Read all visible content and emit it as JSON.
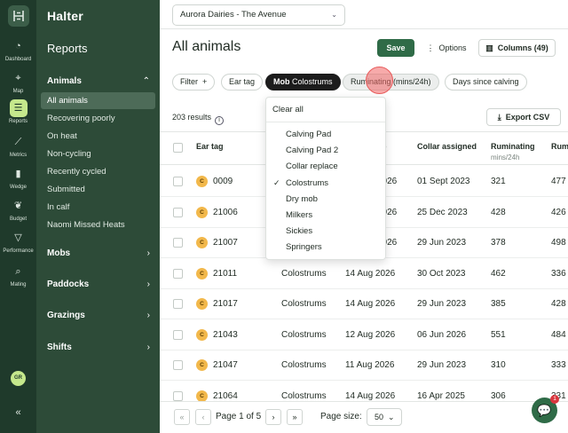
{
  "app": {
    "brand": "Halter"
  },
  "rail": [
    {
      "label": "Dashboard",
      "icon": "gauge-icon"
    },
    {
      "label": "Map",
      "icon": "map-pin-icon"
    },
    {
      "label": "Reports",
      "icon": "list-icon",
      "active": true
    },
    {
      "label": "Metrics",
      "icon": "line-chart-icon"
    },
    {
      "label": "Wedge",
      "icon": "bar-chart-icon"
    },
    {
      "label": "Budget",
      "icon": "sprout-icon"
    },
    {
      "label": "Performance",
      "icon": "cow-icon"
    },
    {
      "label": "Mating",
      "icon": "search-icon"
    }
  ],
  "user_initials": "GR",
  "sidebar": {
    "title": "Reports",
    "animals": {
      "label": "Animals",
      "items": [
        "All animals",
        "Recovering poorly",
        "On heat",
        "Non-cycling",
        "Recently cycled",
        "Submitted",
        "In calf",
        "Naomi Missed Heats"
      ]
    },
    "groups": [
      "Mobs",
      "Paddocks",
      "Grazings",
      "Shifts"
    ]
  },
  "header": {
    "org": "Aurora Dairies - The Avenue",
    "title": "All animals",
    "save": "Save",
    "options": "Options",
    "columns": "Columns (49)"
  },
  "filters": {
    "filter": "Filter",
    "ear_tag": "Ear tag",
    "mob_key": "Mob",
    "mob_value": "Colostrums",
    "ruminating": "Ruminating (mins/24h)",
    "days_since_calving": "Days since calving"
  },
  "results": "203 results",
  "export": "Export CSV",
  "columns": {
    "ear_tag": "Ear tag",
    "mob": "Mob",
    "date_header_tail": "b",
    "collar": "Collar assigned",
    "ruminating": "Ruminating",
    "ruminating_sub": "mins/24h",
    "next": "Rum"
  },
  "rows": [
    {
      "tag": "0009",
      "mob": "",
      "date": "2026",
      "collar": "01 Sept 2023",
      "rum": "321",
      "next": "477"
    },
    {
      "tag": "21006",
      "mob": "",
      "date": "2026",
      "collar": "25 Dec 2023",
      "rum": "428",
      "next": "426"
    },
    {
      "tag": "21007",
      "mob": "",
      "date": "2026",
      "collar": "29 Jun 2023",
      "rum": "378",
      "next": "498"
    },
    {
      "tag": "21011",
      "mob": "Colostrums",
      "date": "14 Aug 2026",
      "collar": "30 Oct 2023",
      "rum": "462",
      "next": "336"
    },
    {
      "tag": "21017",
      "mob": "Colostrums",
      "date": "14 Aug 2026",
      "collar": "29 Jun 2023",
      "rum": "385",
      "next": "428"
    },
    {
      "tag": "21043",
      "mob": "Colostrums",
      "date": "12 Aug 2026",
      "collar": "06 Jun 2026",
      "rum": "551",
      "next": "484"
    },
    {
      "tag": "21047",
      "mob": "Colostrums",
      "date": "11 Aug 2026",
      "collar": "29 Jun 2023",
      "rum": "310",
      "next": "333"
    },
    {
      "tag": "21064",
      "mob": "Colostrums",
      "date": "14 Aug 2026",
      "collar": "16 Apr 2025",
      "rum": "306",
      "next": "331"
    }
  ],
  "tag_letter": "C",
  "dropdown": {
    "clear": "Clear all",
    "options": [
      {
        "label": "Calving Pad",
        "checked": false
      },
      {
        "label": "Calving Pad 2",
        "checked": false
      },
      {
        "label": "Collar replace",
        "checked": false
      },
      {
        "label": "Colostrums",
        "checked": true
      },
      {
        "label": "Dry mob",
        "checked": false
      },
      {
        "label": "Milkers",
        "checked": false
      },
      {
        "label": "Sickies",
        "checked": false
      },
      {
        "label": "Springers",
        "checked": false
      }
    ]
  },
  "pagination": {
    "page_label": "Page 1 of 5",
    "size_label": "Page size:",
    "size_value": "50"
  },
  "chat_badge": "1"
}
